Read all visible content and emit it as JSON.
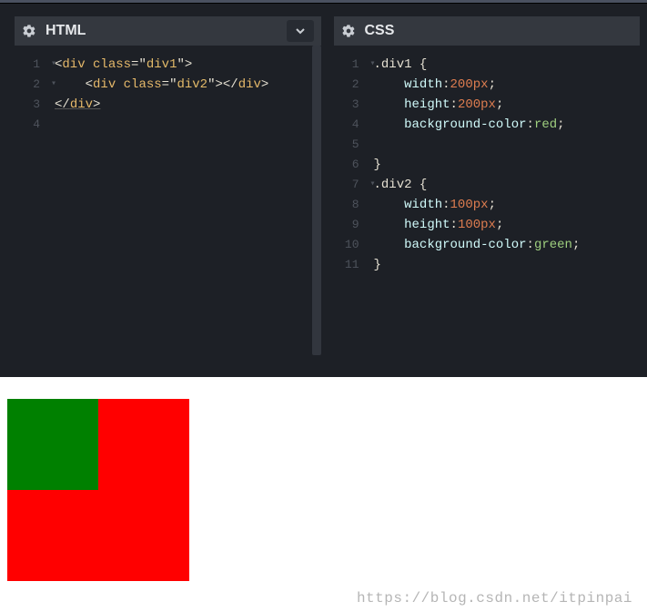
{
  "panels": {
    "html": {
      "title": "HTML",
      "gutter": [
        "1",
        "2",
        "3",
        "4"
      ]
    },
    "css": {
      "title": "CSS",
      "gutter": [
        "1",
        "2",
        "3",
        "4",
        "5",
        "6",
        "7",
        "8",
        "9",
        "10",
        "11"
      ]
    }
  },
  "code": {
    "html": {
      "l1_open_tag": "div",
      "l1_attr": "class",
      "l1_val": "div1",
      "l2_indent": "    ",
      "l2_open_tag": "div",
      "l2_attr": "class",
      "l2_val": "div2",
      "l2_close_tag": "div",
      "l3_close_tag": "div"
    },
    "css": {
      "r1_sel": ".div1",
      "r2_prop": "width",
      "r2_num": "200",
      "r2_unit": "px",
      "r3_prop": "height",
      "r3_num": "200",
      "r3_unit": "px",
      "r4_prop": "background-color",
      "r4_val": "red",
      "r7_sel": ".div2",
      "r8_prop": "width",
      "r8_num": "100",
      "r8_unit": "px",
      "r9_prop": "height",
      "r9_num": "100",
      "r9_unit": "px",
      "r10_prop": "background-color",
      "r10_val": "green",
      "brace_open": " {",
      "brace_close": "}",
      "colon": ":",
      "semi": ";",
      "indent": "    "
    }
  },
  "preview": {
    "div1_size": "200px",
    "div1_color": "#ff0000",
    "div2_size": "100px",
    "div2_color": "#008000"
  },
  "watermark": "https://blog.csdn.net/itpinpai",
  "glyph": {
    "lt": "<",
    "gt": ">",
    "slash": "/",
    "eq": "=",
    "quote": "\""
  }
}
